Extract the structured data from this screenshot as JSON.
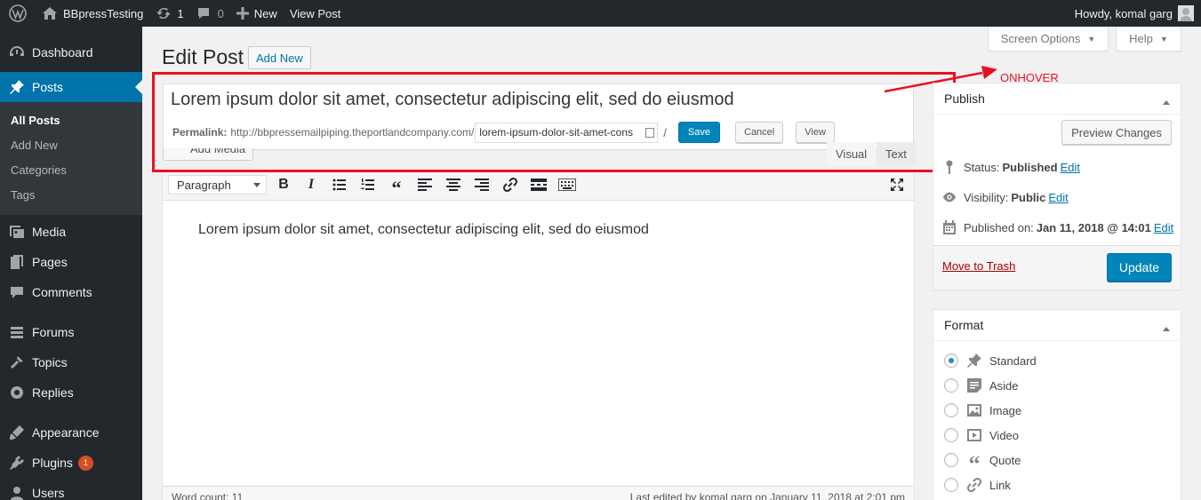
{
  "adminbar": {
    "site_name": "BBpressTesting",
    "updates_count": "1",
    "comments_count": "0",
    "new_label": "New",
    "view_post_label": "View Post",
    "howdy": "Howdy, komal garg"
  },
  "menu": {
    "dashboard": "Dashboard",
    "posts": "Posts",
    "posts_sub": [
      "All Posts",
      "Add New",
      "Categories",
      "Tags"
    ],
    "media": "Media",
    "pages": "Pages",
    "comments": "Comments",
    "forums": "Forums",
    "topics": "Topics",
    "replies": "Replies",
    "appearance": "Appearance",
    "plugins": "Plugins",
    "plugins_badge": "1",
    "users": "Users"
  },
  "screen_meta": {
    "screen_options": "Screen Options",
    "help": "Help"
  },
  "page": {
    "title": "Edit Post",
    "add_new": "Add New"
  },
  "post": {
    "title": "Lorem ipsum dolor sit amet, consectetur adipiscing elit, sed do eiusmod",
    "permalink_label": "Permalink:",
    "permalink_base": "http://bbpressemailpiping.theportlandcompany.com/",
    "slug": "lorem-ipsum-dolor-sit-amet-cons",
    "slug_suffix": "/",
    "save": "Save",
    "cancel": "Cancel",
    "view": "View",
    "add_media": "Add Media",
    "content": "Lorem ipsum dolor sit amet, consectetur adipiscing elit, sed do eiusmod"
  },
  "editor": {
    "tab_visual": "Visual",
    "tab_text": "Text",
    "format_select": "Paragraph",
    "word_count": "Word count: 11",
    "last_edited": "Last edited by komal garg on January 11, 2018 at 2:01 pm"
  },
  "annotation": {
    "label": "ONHOVER",
    "color": "#e81123"
  },
  "publish": {
    "heading": "Publish",
    "preview": "Preview Changes",
    "status_label": "Status:",
    "status_value": "Published",
    "visibility_label": "Visibility:",
    "visibility_value": "Public",
    "published_label": "Published on:",
    "published_value": "Jan 11, 2018 @ 14:01",
    "edit": "Edit",
    "trash": "Move to Trash",
    "update": "Update"
  },
  "format": {
    "heading": "Format",
    "options": [
      "Standard",
      "Aside",
      "Image",
      "Video",
      "Quote",
      "Link"
    ],
    "selected": "Standard"
  },
  "colors": {
    "admin_bar": "#23282d",
    "accent": "#0073aa",
    "primary_button": "#0085ba"
  }
}
